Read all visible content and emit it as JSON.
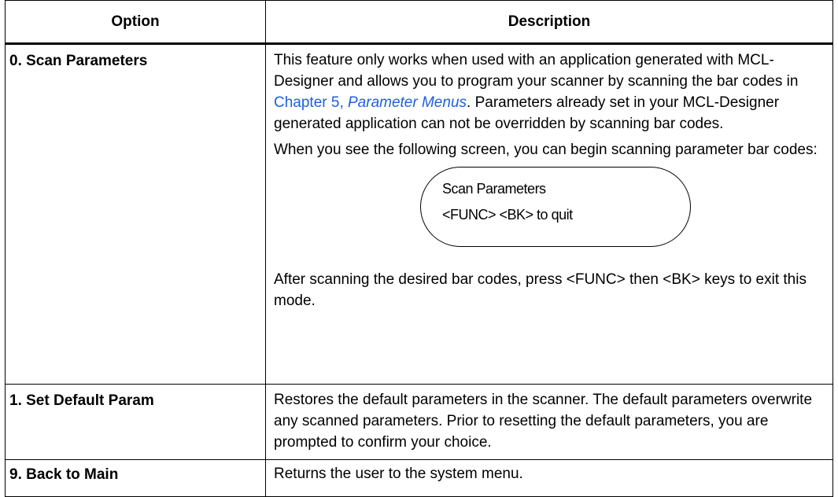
{
  "table": {
    "headers": {
      "option": "Option",
      "description": "Description"
    },
    "rows": [
      {
        "option": "0. Scan Parameters",
        "para1_before": "This feature only works when used with an application generated with MCL-Designer and allows you to program your scanner by scanning the bar codes in ",
        "link_chapter": "Chapter 5, ",
        "link_title": "Parameter Menus",
        "para1_after": ". Parameters already set in your MCL-Designer generated application can not be overridden by scanning bar codes.",
        "para2": "When you see the following screen, you can begin scanning parameter bar codes:",
        "screen_line1": "Scan Parameters",
        "screen_line2": "<FUNC> <BK> to quit",
        "para3": "After scanning the desired bar codes, press <FUNC> then <BK> keys to exit this mode."
      },
      {
        "option": "1. Set Default Param",
        "description": "Restores the default parameters in the scanner. The default parameters overwrite any scanned parameters. Prior to resetting the default parameters, you are prompted to confirm your choice."
      },
      {
        "option": "9. Back to Main",
        "description": "Returns the user to the system menu."
      }
    ]
  }
}
